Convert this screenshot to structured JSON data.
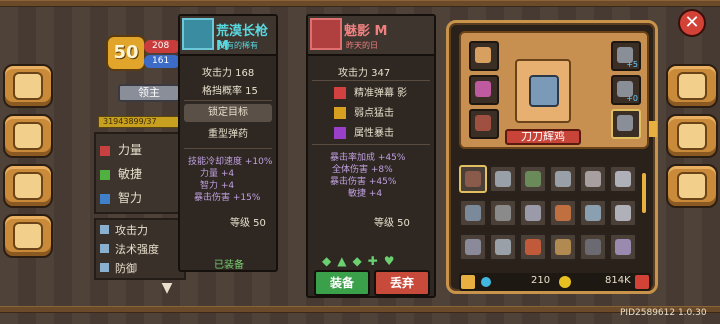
{
  "left_tabs": [
    {
      "name": "book"
    },
    {
      "name": "skills"
    },
    {
      "name": "pet"
    },
    {
      "name": "vehicle"
    }
  ],
  "right_tabs": [
    {
      "name": "helmet"
    },
    {
      "name": "tools"
    },
    {
      "name": "items"
    }
  ],
  "level_badge": "50",
  "hp_text": "208",
  "mp_text": "161",
  "leader_button": "领主",
  "exp_text": "31943899/37",
  "stats": [
    {
      "label": "力量",
      "color": "#c84040"
    },
    {
      "label": "敏捷",
      "color": "#50b040"
    },
    {
      "label": "智力",
      "color": "#4080c8"
    }
  ],
  "bottom_stats": [
    {
      "label": "攻击力"
    },
    {
      "label": "法术强度"
    },
    {
      "label": "防御"
    }
  ],
  "weapon1": {
    "name": "荒漠长枪 M",
    "subtitle": "拥有的稀有",
    "name_color": "#5ad8e0",
    "attack_line": "攻击力 168",
    "block_line": "格挡概率 15",
    "skills": [
      {
        "label": "锁定目标"
      },
      {
        "label": "重型弹药"
      }
    ],
    "bonuses": [
      "技能冷却速度 +10%",
      "力量 +4",
      "智力 +4",
      "暴击伤害 +15%"
    ],
    "level": "等级 50",
    "equipped": "已装备"
  },
  "weapon2": {
    "name": "魅影 M",
    "subtitle": "昨天的日",
    "name_color": "#f08080",
    "attack_line": "攻击力 347",
    "skills": [
      {
        "label": "精准弹幕 影"
      },
      {
        "label": "弱点猛击"
      },
      {
        "label": "属性暴击"
      }
    ],
    "bonuses": [
      "暴击率加成 +45%",
      "全体伤害 +8%",
      "暴击伤害 +45%",
      "敏捷 +4"
    ],
    "level": "等级 50",
    "equip_button": "装备",
    "discard_button": "丢弃"
  },
  "character_name": "刀刀辉鸡",
  "slot_badges": [
    "+5",
    "+0"
  ],
  "currency": {
    "gems": "210",
    "coins": "814K"
  },
  "build_id": "PID2589612 1.0.30",
  "colors": {
    "accent": "#c8934a",
    "green_button": "#3aa04a",
    "red_button": "#c84a3a"
  }
}
